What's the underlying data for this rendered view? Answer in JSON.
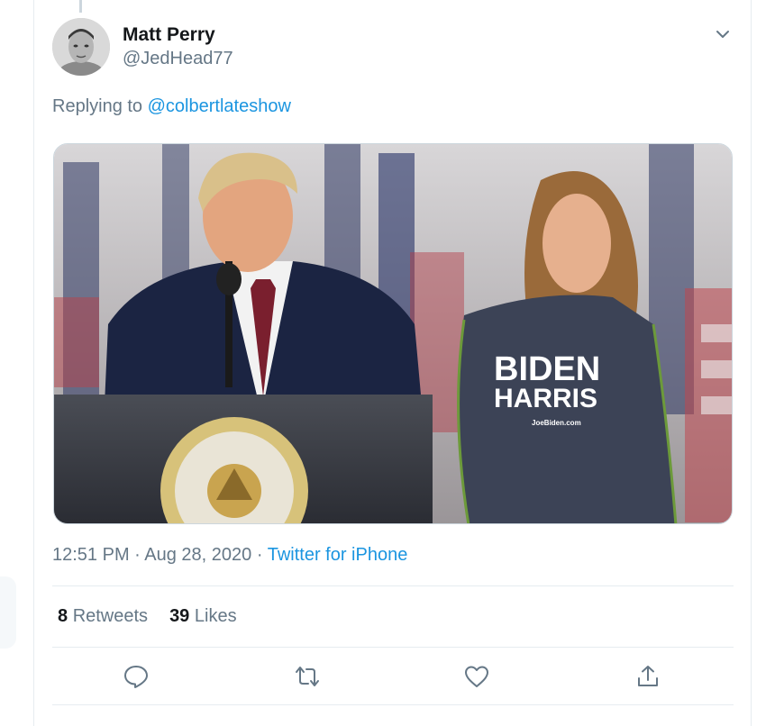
{
  "author": {
    "name": "Matt Perry",
    "handle": "@JedHead77"
  },
  "reply": {
    "prefix": "Replying to ",
    "mention": "@colbertlateshow"
  },
  "media": {
    "shirt_line1": "BIDEN",
    "shirt_line2": "HARRIS",
    "shirt_url": "JoeBiden.com"
  },
  "meta": {
    "time": "12:51 PM",
    "sep1": " · ",
    "date": "Aug 28, 2020",
    "sep2": " · ",
    "source": "Twitter for iPhone"
  },
  "stats": {
    "retweets_count": "8",
    "retweets_label": "Retweets",
    "likes_count": "39",
    "likes_label": "Likes"
  },
  "icons": {
    "reply": "reply-icon",
    "retweet": "retweet-icon",
    "like": "like-icon",
    "share": "share-icon",
    "caret": "chevron-down-icon"
  },
  "colors": {
    "link": "#1b95e0",
    "muted": "#657786",
    "text": "#14171a",
    "border": "#e6ecf0"
  }
}
